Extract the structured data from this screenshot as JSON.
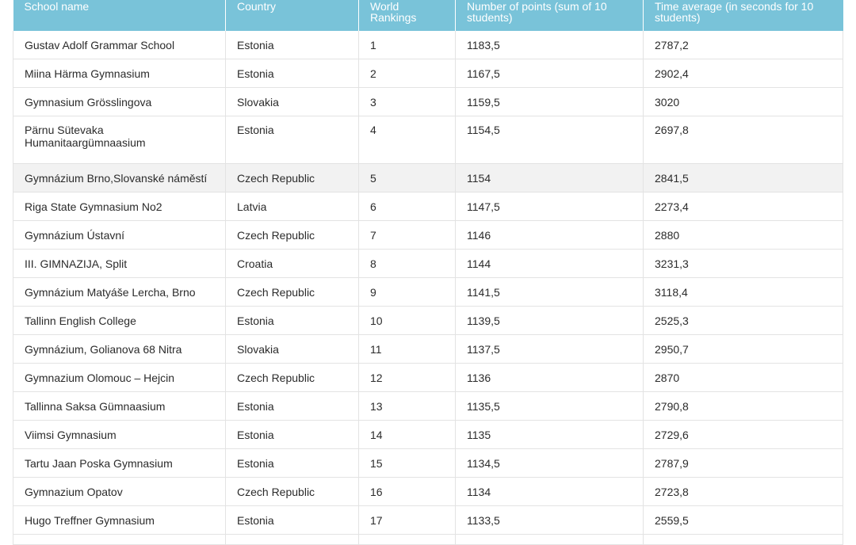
{
  "table": {
    "headers": [
      "School name",
      "Country",
      "World Rankings",
      "Number of points (sum of 10 students)",
      "Time average (in seconds for 10 students)"
    ],
    "rows": [
      [
        "Gustav Adolf Grammar School",
        "Estonia",
        "1",
        "1183,5",
        "2787,2"
      ],
      [
        "Miina Härma Gymnasium",
        "Estonia",
        "2",
        "1167,5",
        "2902,4"
      ],
      [
        "Gymnasium Grösslingova",
        "Slovakia",
        "3",
        "1159,5",
        "3020"
      ],
      [
        "Pärnu Sütevaka Humanitaargümnaasium",
        "Estonia",
        "4",
        "1154,5",
        "2697,8"
      ],
      [
        "Gymnázium Brno,Slovanské náměstí",
        "Czech Republic",
        "5",
        "1154",
        "2841,5"
      ],
      [
        "Riga State Gymnasium No2",
        "Latvia",
        "6",
        "1147,5",
        "2273,4"
      ],
      [
        "Gymnázium Ústavní",
        "Czech Republic",
        "7",
        "1146",
        "2880"
      ],
      [
        "III. GIMNAZIJA, Split",
        "Croatia",
        "8",
        "1144",
        "3231,3"
      ],
      [
        "Gymnázium Matyáše Lercha, Brno",
        "Czech Republic",
        "9",
        "1141,5",
        "3118,4"
      ],
      [
        "Tallinn English College",
        "Estonia",
        "10",
        "1139,5",
        "2525,3"
      ],
      [
        "Gymnázium, Golianova 68 Nitra",
        "Slovakia",
        "11",
        "1137,5",
        "2950,7"
      ],
      [
        "Gymnazium Olomouc – Hejcin",
        "Czech Republic",
        "12",
        "1136",
        "2870"
      ],
      [
        "Tallinna Saksa Gümnaasium",
        "Estonia",
        "13",
        "1135,5",
        "2790,8"
      ],
      [
        "Viimsi Gymnasium",
        "Estonia",
        "14",
        "1135",
        "2729,6"
      ],
      [
        "Tartu Jaan Poska Gymnasium",
        "Estonia",
        "15",
        "1134,5",
        "2787,9"
      ],
      [
        "Gymnazium Opatov",
        "Czech Republic",
        "16",
        "1134",
        "2723,8"
      ],
      [
        "Hugo Treffner Gymnasium",
        "Estonia",
        "17",
        "1133,5",
        "2559,5"
      ]
    ],
    "highlighted_row": 4,
    "colors": {
      "header_bg": "#79c3d9",
      "header_text": "#ffffff",
      "highlight_bg": "#f2f2f2",
      "border": "#e3e3e3"
    }
  }
}
